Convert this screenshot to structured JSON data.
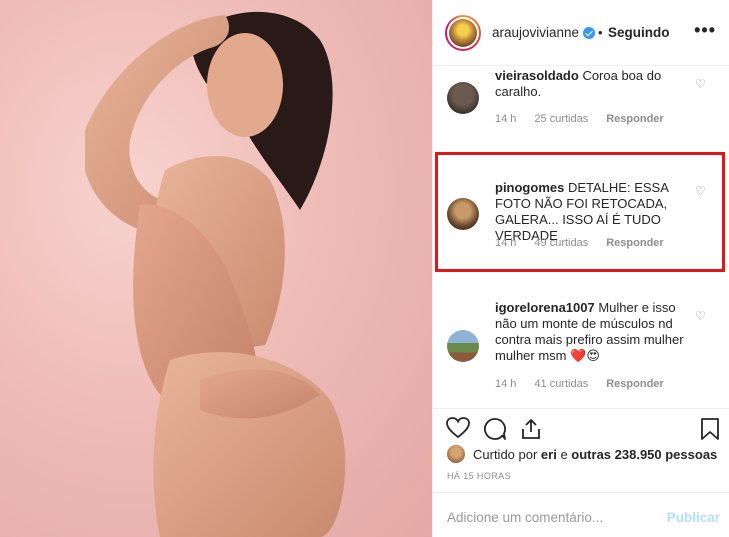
{
  "post": {
    "image_alt": "pink-toned portrait photo of a woman"
  },
  "header": {
    "username": "araujovivianne",
    "separator": "•",
    "follow_status": "Seguindo",
    "more_icon": "more-horizontal-icon"
  },
  "comments": [
    {
      "username": "vieirasoldado",
      "text": "Coroa boa do caralho.",
      "time": "14 h",
      "likes": "25 curtidas",
      "reply": "Responder"
    },
    {
      "username": "pinogomes",
      "text": "DETALHE: ESSA FOTO NÃO FOI RETOCADA, GALERA... ISSO AÍ É TUDO VERDADE",
      "time": "14 h",
      "likes": "49 curtidas",
      "reply": "Responder"
    },
    {
      "username": "igorelorena1007",
      "text": "Mulher e isso não um monte de músculos nd contra mais prefiro assim mulher mulher msm",
      "emoji": "❤️😍",
      "time": "14 h",
      "likes": "41 curtidas",
      "reply": "Responder"
    }
  ],
  "actions": {
    "like_icon": "heart-icon",
    "comment_icon": "comment-icon",
    "share_icon": "share-icon",
    "save_icon": "bookmark-icon"
  },
  "likes_summary": {
    "prefix": "Curtido por ",
    "user": "eri",
    "middle": " e ",
    "others": "outras 238.950 pessoas"
  },
  "timestamp": "HÁ 15 HORAS",
  "comment_box": {
    "placeholder": "Adicione um comentário...",
    "publish_label": "Publicar"
  },
  "colors": {
    "highlight_border": "#e2151b",
    "verified": "#3897f0",
    "publish_disabled": "#b2dffc",
    "muted_text": "#8e8e8e"
  }
}
